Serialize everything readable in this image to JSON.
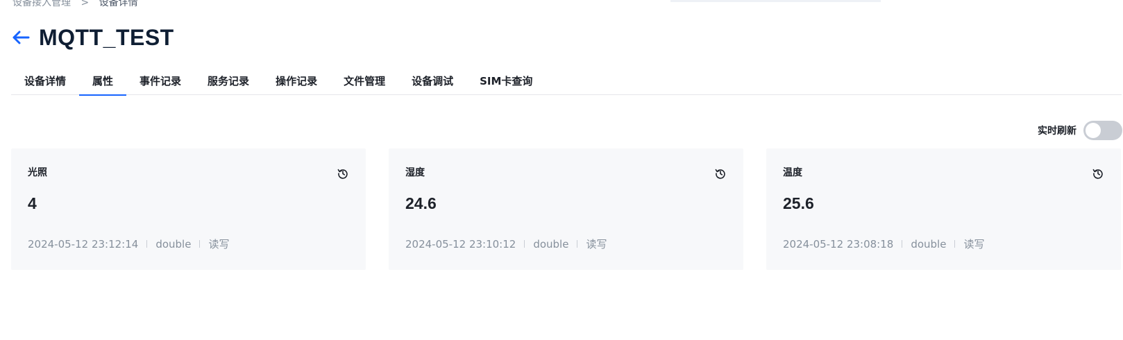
{
  "breadcrumb": {
    "parent": "设备接入管理",
    "separator": ">",
    "current": "设备详情"
  },
  "header": {
    "back_icon": "arrow-left-icon",
    "title": "MQTT_TEST"
  },
  "tabs": [
    {
      "label": "设备详情",
      "active": false
    },
    {
      "label": "属性",
      "active": true
    },
    {
      "label": "事件记录",
      "active": false
    },
    {
      "label": "服务记录",
      "active": false
    },
    {
      "label": "操作记录",
      "active": false
    },
    {
      "label": "文件管理",
      "active": false
    },
    {
      "label": "设备调试",
      "active": false
    },
    {
      "label": "SIM卡查询",
      "active": false
    }
  ],
  "realtime_refresh": {
    "label": "实时刷新",
    "enabled": false
  },
  "properties": [
    {
      "name": "光照",
      "value": "4",
      "timestamp": "2024-05-12 23:12:14",
      "type": "double",
      "access": "读写"
    },
    {
      "name": "湿度",
      "value": "24.6",
      "timestamp": "2024-05-12 23:10:12",
      "type": "double",
      "access": "读写"
    },
    {
      "name": "温度",
      "value": "25.6",
      "timestamp": "2024-05-12 23:08:18",
      "type": "double",
      "access": "读写"
    }
  ],
  "colors": {
    "accent": "#1664ff",
    "title": "#0f1e33",
    "muted": "#86909c",
    "card_bg": "#f7f8fa"
  }
}
